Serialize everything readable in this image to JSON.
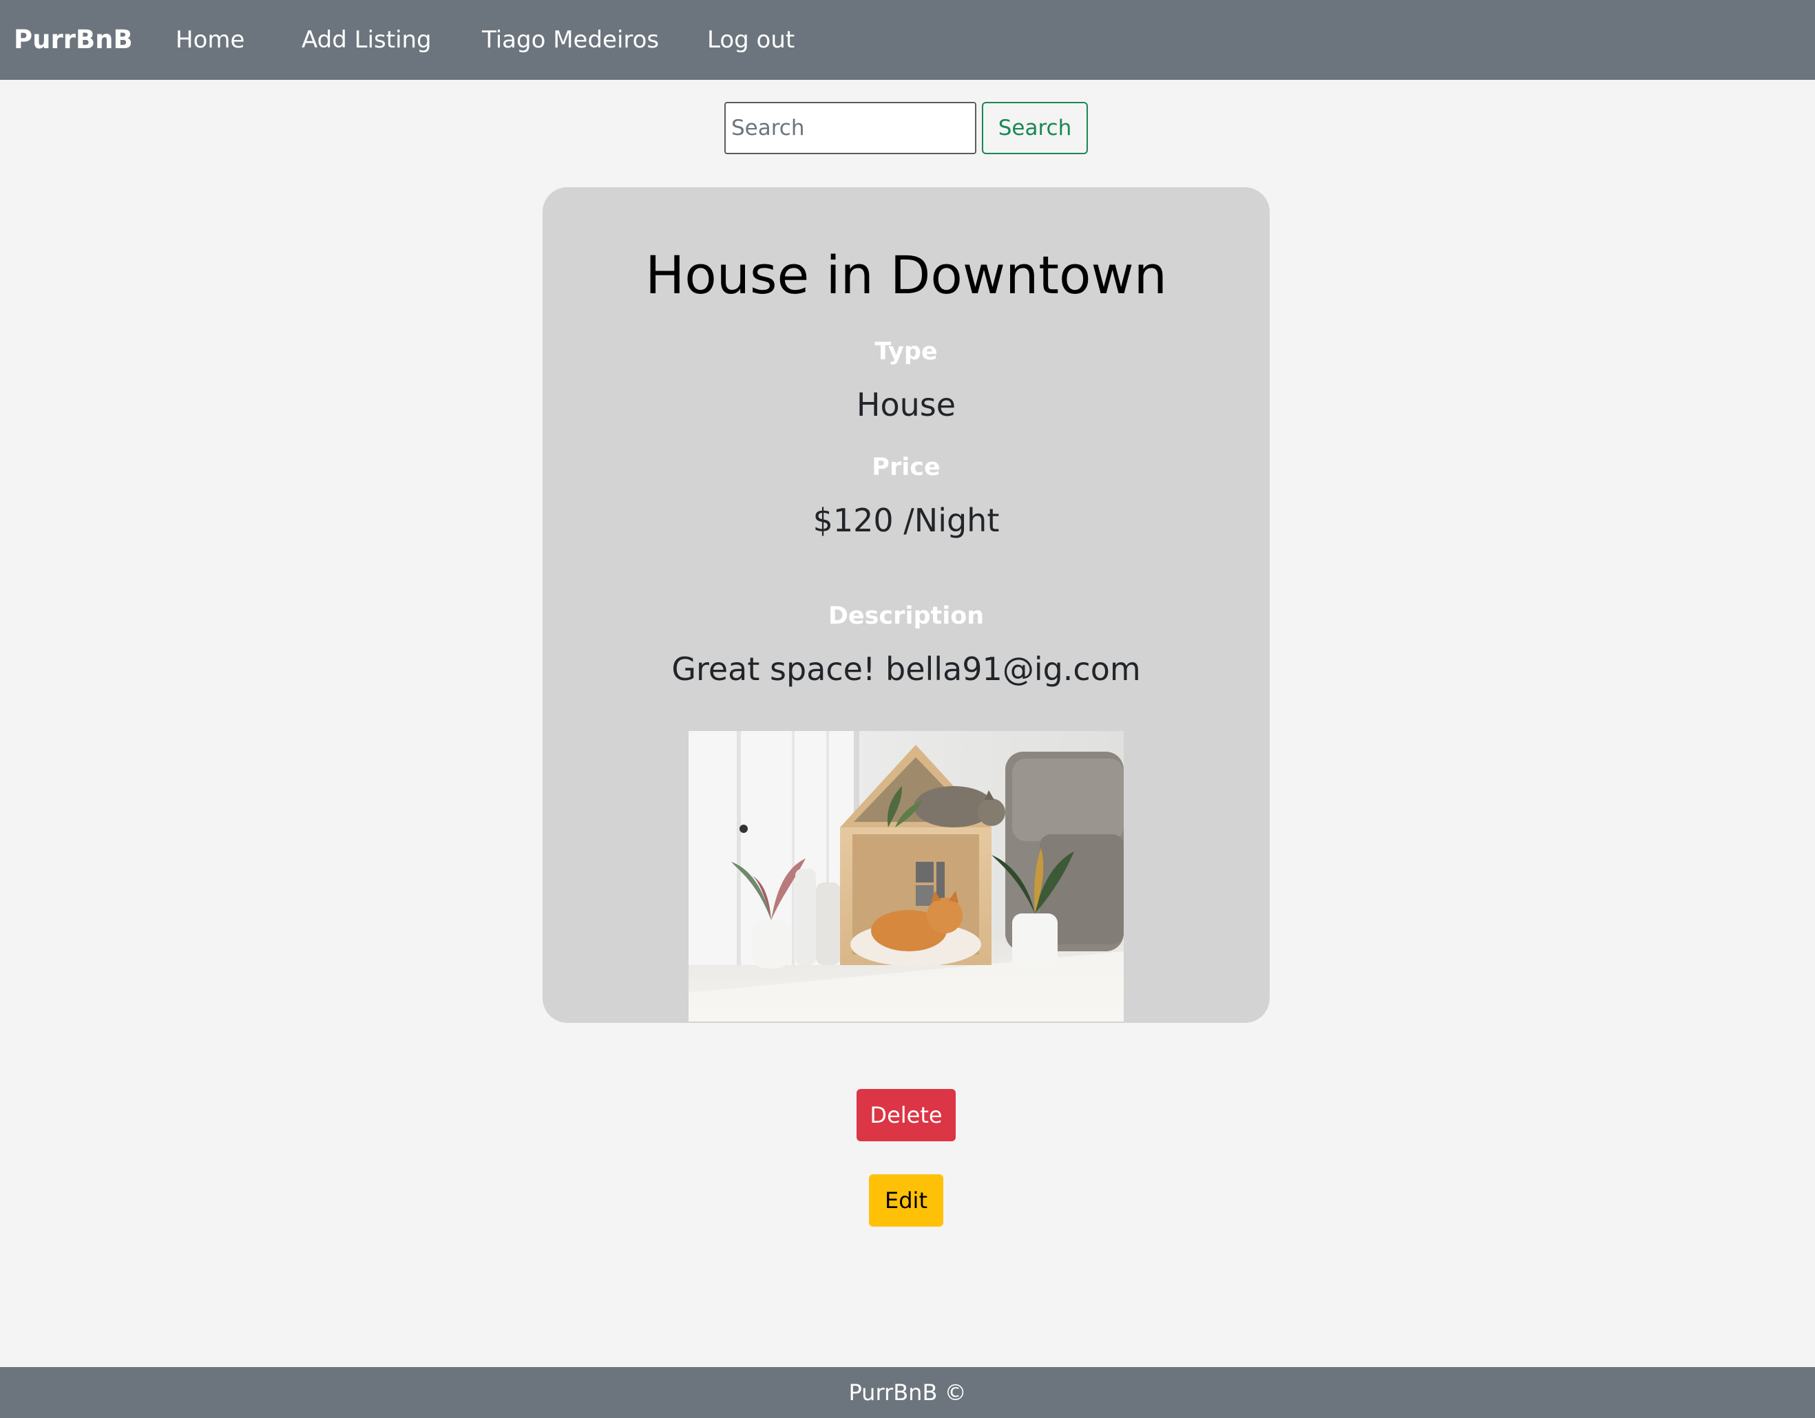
{
  "navbar": {
    "brand": "PurrBnB",
    "links": [
      {
        "label": "Home"
      },
      {
        "label": "Add Listing"
      },
      {
        "label": "Tiago Medeiros"
      },
      {
        "label": "Log out"
      }
    ]
  },
  "search": {
    "placeholder": "Search",
    "value": "",
    "button_label": "Search"
  },
  "listing": {
    "title": "House in Downtown",
    "type_label": "Type",
    "type_value": "House",
    "price_label": "Price",
    "price_value": "$120 /Night",
    "description_label": "Description",
    "description_value": "Great space! bella91@ig.com",
    "image_alt": "Two cats in a wooden cat house next to plants and a sofa"
  },
  "actions": {
    "delete_label": "Delete",
    "edit_label": "Edit"
  },
  "footer": {
    "text": "PurrBnB ©"
  },
  "colors": {
    "navbar_bg": "#6c757d",
    "page_bg": "#f4f4f4",
    "card_bg": "#d3d3d3",
    "search_button": "#198754",
    "delete_button": "#dc3545",
    "edit_button": "#ffc107"
  }
}
